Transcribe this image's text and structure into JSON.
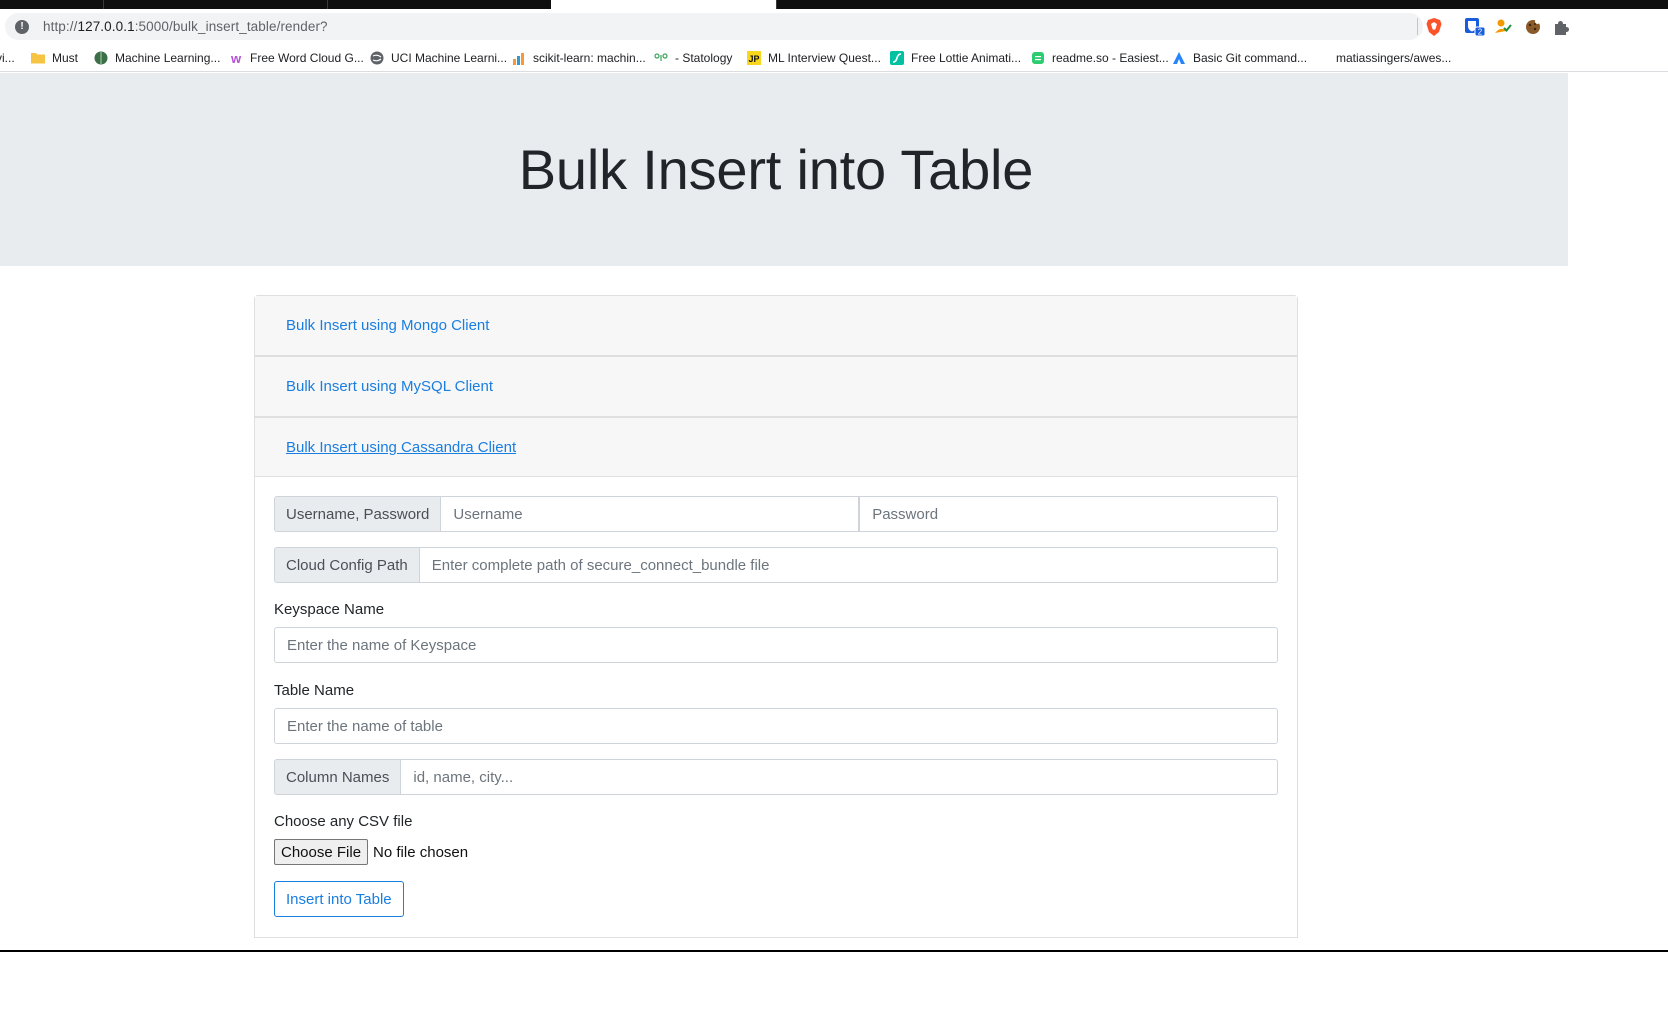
{
  "browser": {
    "url_scheme": "http://",
    "url_host": "127.0.0.1",
    "url_path": ":5000/bulk_insert_table/render?",
    "extension_badge": "2",
    "bookmarks": [
      {
        "label": "vi...",
        "icon": "partial-icon"
      },
      {
        "label": "Must",
        "icon": "folder-icon"
      },
      {
        "label": "Machine Learning...",
        "icon": "brain-icon"
      },
      {
        "label": "Free Word Cloud G...",
        "icon": "wordcloud-icon"
      },
      {
        "label": "UCI Machine Learni...",
        "icon": "globe-icon"
      },
      {
        "label": "scikit-learn: machin...",
        "icon": "bar-chart-icon"
      },
      {
        "label": "- Statology",
        "icon": "statology-icon"
      },
      {
        "label": "ML Interview Quest...",
        "icon": "jp-icon"
      },
      {
        "label": "Free Lottie Animati...",
        "icon": "lottie-icon"
      },
      {
        "label": "readme.so - Easiest...",
        "icon": "readme-icon"
      },
      {
        "label": "Basic Git command...",
        "icon": "atlassian-icon"
      },
      {
        "label": "matiassingers/awes...",
        "icon": "none"
      }
    ]
  },
  "page": {
    "title": "Bulk Insert into Table",
    "accordion": [
      {
        "label": "Bulk Insert using Mongo Client"
      },
      {
        "label": "Bulk Insert using MySQL Client"
      },
      {
        "label": "Bulk Insert using Cassandra Client"
      }
    ],
    "form": {
      "credentials_label": "Username, Password",
      "username_placeholder": "Username",
      "password_placeholder": "Password",
      "cloud_config_label": "Cloud Config Path",
      "cloud_config_placeholder": "Enter complete path of secure_connect_bundle file",
      "keyspace_label": "Keyspace Name",
      "keyspace_placeholder": "Enter the name of Keyspace",
      "table_label": "Table Name",
      "table_placeholder": "Enter the name of table",
      "columns_label": "Column Names",
      "columns_placeholder": "id, name, city...",
      "csv_label": "Choose any CSV file",
      "choose_file_button": "Choose File",
      "file_status": "No file chosen",
      "submit_button": "Insert into Table"
    }
  },
  "colors": {
    "link": "#1a7ee0",
    "jumbotron_bg": "#e9ecef",
    "card_header_bg": "#f7f7f7"
  }
}
